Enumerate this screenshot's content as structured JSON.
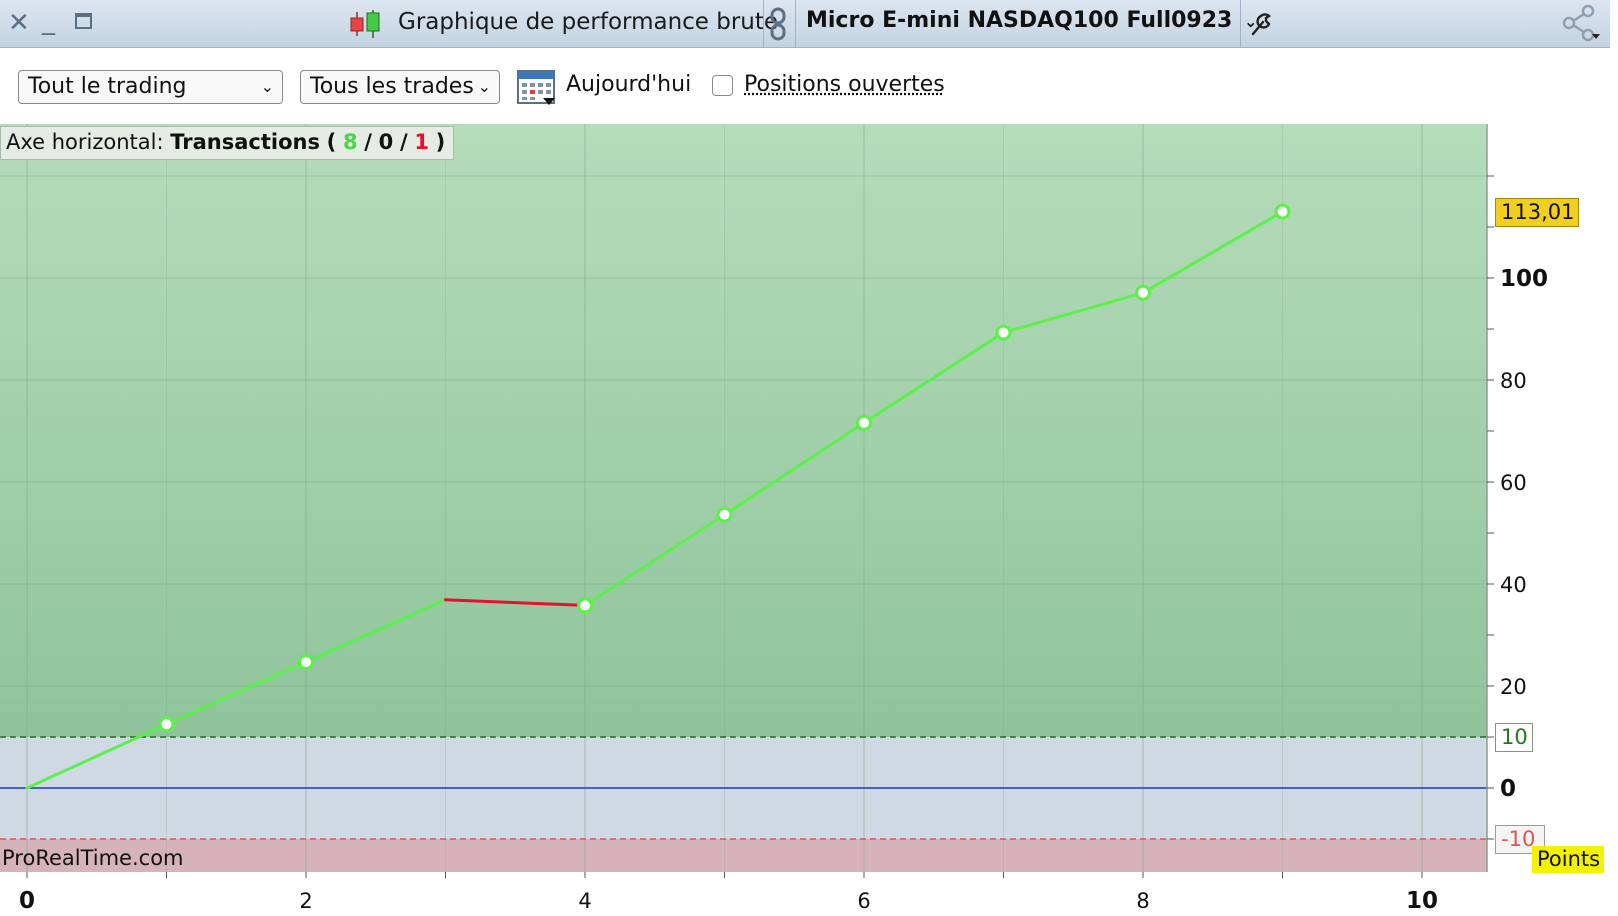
{
  "window": {
    "title": "Graphique de performance brute",
    "instrument": "Micro E-mini NASDAQ100 Full0923"
  },
  "toolbar": {
    "trading_select": "Tout le trading",
    "trades_select": "Tous les trades",
    "date_label": "Aujourd'hui",
    "open_positions_label": "Positions ouvertes",
    "open_positions_checked": false
  },
  "axis_info": {
    "prefix": "Axe horizontal:",
    "mode": "Transactions",
    "open_paren": "(",
    "wins": "8",
    "sep1": "/",
    "neutral": "0",
    "sep2": "/",
    "losses": "1",
    "close_paren": ")"
  },
  "watermark": "ProRealTime.com",
  "units_badge": "Points",
  "current_value_label": "113,01",
  "threshold_upper_label": "10",
  "threshold_lower_label": "-10",
  "colors": {
    "gain_line": "#5cf04a",
    "loss_line": "#e8102c",
    "zero_line": "#2233cc",
    "profit_zone": "#a8d4ae",
    "neutral_zone": "#ced9e3",
    "loss_zone": "#d6b3bb",
    "value_badge": "#f2cf1e",
    "units_badge": "#f5f200"
  },
  "chart_data": {
    "type": "line",
    "title": "Graphique de performance brute",
    "xlabel": "",
    "ylabel": "Points",
    "x_ticks": [
      "0",
      "2",
      "4",
      "6",
      "8",
      "10"
    ],
    "y_ticks": [
      "0",
      "20",
      "40",
      "60",
      "80",
      "100"
    ],
    "xlim": [
      0,
      10.5
    ],
    "ylim": [
      -17,
      130
    ],
    "grid": true,
    "series": [
      {
        "x": [
          0,
          1,
          2,
          3,
          4,
          5,
          6,
          7,
          8,
          9
        ],
        "y": [
          0,
          12.5,
          24.7,
          36.9,
          35.8,
          53.6,
          71.6,
          89.3,
          97.1,
          113.01
        ],
        "segment_result": [
          "gain",
          "gain",
          "gain",
          "loss",
          "gain",
          "gain",
          "gain",
          "gain",
          "gain"
        ]
      }
    ],
    "last_value": 113.01,
    "thresholds": [
      10,
      -10
    ]
  }
}
